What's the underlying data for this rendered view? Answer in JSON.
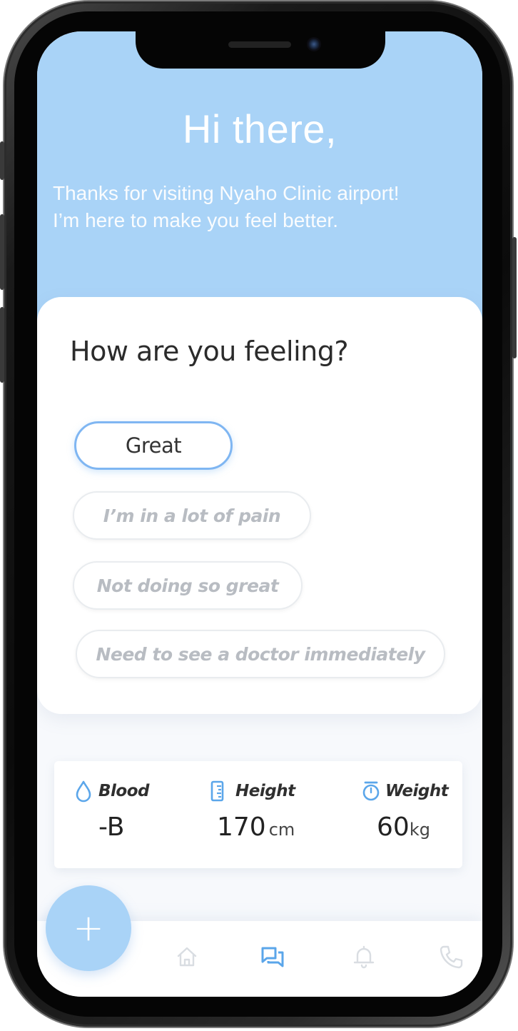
{
  "header": {
    "greeting": "Hi there,",
    "subtitle_line1": "Thanks for visiting Nyaho Clinic airport!",
    "subtitle_line2": "I’m here to make you feel better."
  },
  "feeling_card": {
    "title": "How are you feeling?",
    "options": [
      {
        "label": "Great",
        "selected": true
      },
      {
        "label": "I’m in a lot of pain",
        "selected": false
      },
      {
        "label": "Not doing so great",
        "selected": false
      },
      {
        "label": "Need to see a doctor immediately",
        "selected": false
      }
    ]
  },
  "stats": {
    "blood": {
      "label": "Blood",
      "value": "-B",
      "icon": "drop-icon"
    },
    "height": {
      "label": "Height",
      "value": "170",
      "unit": "cm",
      "icon": "ruler-icon"
    },
    "weight": {
      "label": "Weight",
      "value": "60",
      "unit": "kg",
      "icon": "scale-icon"
    }
  },
  "fab": {
    "label": "+",
    "icon": "plus-icon"
  },
  "nav": {
    "items": [
      {
        "name": "home",
        "icon": "home-icon",
        "active": false
      },
      {
        "name": "chat",
        "icon": "chat-icon",
        "active": true
      },
      {
        "name": "notifications",
        "icon": "bell-icon",
        "active": false
      },
      {
        "name": "call",
        "icon": "phone-icon",
        "active": false
      }
    ]
  },
  "colors": {
    "accent": "#a9d3f7",
    "accent_dark": "#5ba6ea",
    "selected_border": "#7fb6f2",
    "muted_text": "#b8bcc2",
    "nav_inactive": "#d9dde2"
  }
}
